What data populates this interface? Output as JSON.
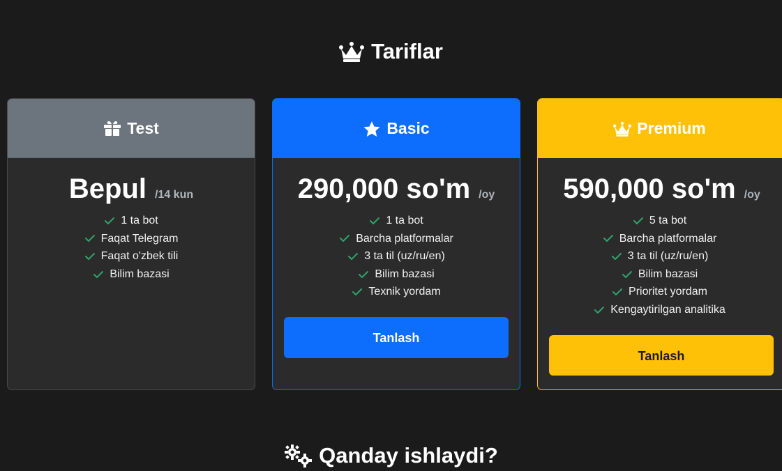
{
  "page": {
    "title": "Tariflar",
    "title_icon": "crown-icon",
    "next_section_title": "Qanday ishlaydi?",
    "next_section_icon": "gears-icon"
  },
  "colors": {
    "background": "#1b1b1b",
    "card_body": "#2b2b2b",
    "test_header": "#6c757d",
    "basic_accent": "#0d6efd",
    "premium_accent": "#ffc107",
    "check": "#2fa36b"
  },
  "plans": {
    "test": {
      "name": "Test",
      "icon": "gift-icon",
      "price": "Bepul",
      "period": "/14 kun",
      "features": [
        "1 ta bot",
        "Faqat Telegram",
        "Faqat o'zbek tili",
        "Bilim bazasi"
      ]
    },
    "basic": {
      "name": "Basic",
      "icon": "star-icon",
      "price": "290,000 so'm",
      "period": "/oy",
      "features": [
        "1 ta bot",
        "Barcha platformalar",
        "3 ta til (uz/ru/en)",
        "Bilim bazasi",
        "Texnik yordam"
      ],
      "button": "Tanlash"
    },
    "premium": {
      "name": "Premium",
      "icon": "crown-icon",
      "price": "590,000 so'm",
      "period": "/oy",
      "features": [
        "5 ta bot",
        "Barcha platformalar",
        "3 ta til (uz/ru/en)",
        "Bilim bazasi",
        "Prioritet yordam",
        "Kengaytirilgan analitika"
      ],
      "button": "Tanlash"
    }
  }
}
